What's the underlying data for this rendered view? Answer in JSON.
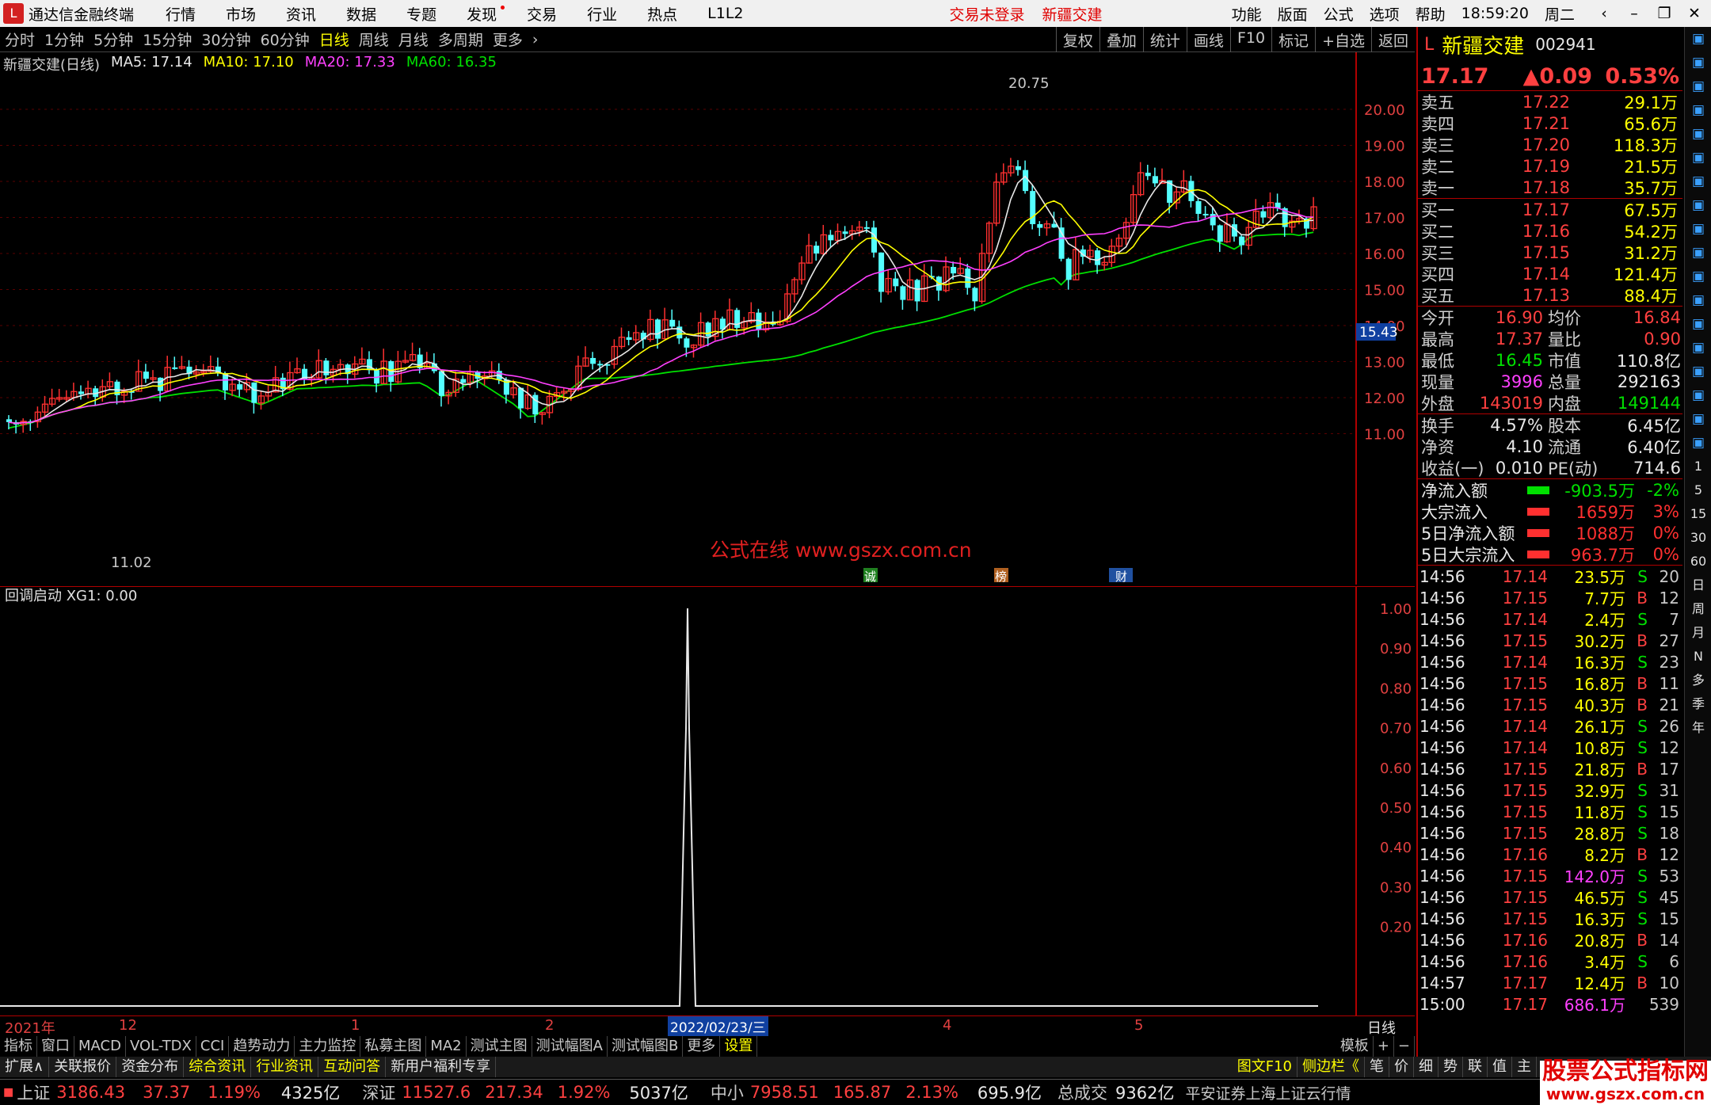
{
  "menubar": {
    "app_title": "通达信金融终端",
    "items": [
      "行情",
      "市场",
      "资讯",
      "数据",
      "专题",
      "发现",
      "交易",
      "行业",
      "热点",
      "L1L2"
    ],
    "trade_status": "交易未登录",
    "stock_name": "新疆交建",
    "right_items": [
      "功能",
      "版面",
      "公式",
      "选项",
      "帮助"
    ],
    "time": "18:59:20",
    "weekday": "周二"
  },
  "periodbar": {
    "periods": [
      "分时",
      "1分钟",
      "5分钟",
      "15分钟",
      "30分钟",
      "60分钟",
      "日线",
      "周线",
      "月线",
      "多周期",
      "更多"
    ],
    "active": "日线",
    "tools": [
      "复权",
      "叠加",
      "统计",
      "画线",
      "F10",
      "标记",
      "+自选",
      "返回"
    ]
  },
  "ma_header": {
    "title": "新疆交建(日线)",
    "ma5": "MA5: 17.14",
    "ma10": "MA10: 17.10",
    "ma20": "MA20: 17.33",
    "ma60": "MA60: 16.35"
  },
  "main_chart": {
    "y_labels": [
      "20.00",
      "19.00",
      "18.00",
      "17.00",
      "16.00",
      "15.00",
      "14.00",
      "13.00",
      "12.00",
      "11.00"
    ],
    "high_label": "20.75",
    "low_label": "11.02",
    "current_price_tag": "15.43",
    "watermark": "公式在线  www.gszx.com.cn",
    "markers": [
      "诚",
      "榜",
      "财"
    ]
  },
  "sub_chart": {
    "title": "回调启动  XG1: 0.00",
    "y_labels": [
      "1.00",
      "0.90",
      "0.80",
      "0.70",
      "0.60",
      "0.50",
      "0.40",
      "0.30",
      "0.20"
    ]
  },
  "datebar": {
    "labels": [
      "2021年",
      "12",
      "1",
      "2",
      "4",
      "5"
    ],
    "cursor_date": "2022/02/23/三",
    "period_label": "日线"
  },
  "tabbar": {
    "tabs": [
      "指标",
      "窗口",
      "MACD",
      "VOL-TDX",
      "CCI",
      "趋势动力",
      "主力监控",
      "私募主图",
      "MA2",
      "测试主图",
      "测试幅图A",
      "测试幅图B",
      "更多",
      "设置"
    ],
    "right": [
      "模板",
      "+",
      "−"
    ]
  },
  "extbar": {
    "items": [
      "扩展∧",
      "关联报价",
      "资金分布",
      "综合资讯",
      "行业资讯",
      "互动问答",
      "新用户福利专享"
    ],
    "right": [
      "图文F10",
      "侧边栏《",
      "笔",
      "价",
      "细",
      "势",
      "联",
      "值",
      "主"
    ]
  },
  "statusbar": {
    "sh_label": "上证",
    "sh_val": "3186.43",
    "sh_chg": "37.37",
    "sh_pct": "1.19%",
    "sh_amt": "4325亿",
    "sz_label": "深证",
    "sz_val": "11527.6",
    "sz_chg": "217.34",
    "sz_pct": "1.92%",
    "sz_amt": "5037亿",
    "zx_label": "中小",
    "zx_val": "7958.51",
    "zx_chg": "165.87",
    "zx_pct": "2.13%",
    "zx_amt": "695.9亿",
    "total_label": "总成交",
    "total_val": "9362亿",
    "broker": "平安证券上海上证云行情"
  },
  "quote": {
    "name": "新疆交建",
    "code": "002941",
    "price": "17.17",
    "change": "▲0.09",
    "pct": "0.53%",
    "asks": [
      {
        "label": "卖五",
        "price": "17.22",
        "vol": "29.1万"
      },
      {
        "label": "卖四",
        "price": "17.21",
        "vol": "65.6万"
      },
      {
        "label": "卖三",
        "price": "17.20",
        "vol": "118.3万"
      },
      {
        "label": "卖二",
        "price": "17.19",
        "vol": "21.5万"
      },
      {
        "label": "卖一",
        "price": "17.18",
        "vol": "35.7万"
      }
    ],
    "bids": [
      {
        "label": "买一",
        "price": "17.17",
        "vol": "67.5万"
      },
      {
        "label": "买二",
        "price": "17.16",
        "vol": "54.2万"
      },
      {
        "label": "买三",
        "price": "17.15",
        "vol": "31.2万"
      },
      {
        "label": "买四",
        "price": "17.14",
        "vol": "121.4万"
      },
      {
        "label": "买五",
        "price": "17.13",
        "vol": "88.4万"
      }
    ],
    "stats1": [
      {
        "a": "今开",
        "av": "16.90",
        "b": "均价",
        "bv": "16.84"
      },
      {
        "a": "最高",
        "av": "17.37",
        "b": "量比",
        "bv": "0.90"
      },
      {
        "a": "最低",
        "av": "16.45",
        "b": "市值",
        "bv": "110.8亿"
      },
      {
        "a": "现量",
        "av": "3996",
        "b": "总量",
        "bv": "292163"
      },
      {
        "a": "外盘",
        "av": "143019",
        "b": "内盘",
        "bv": "149144"
      }
    ],
    "stats2": [
      {
        "a": "换手",
        "av": "4.57%",
        "b": "股本",
        "bv": "6.45亿"
      },
      {
        "a": "净资",
        "av": "4.10",
        "b": "流通",
        "bv": "6.40亿"
      },
      {
        "a": "收益(一)",
        "av": "0.010",
        "b": "PE(动)",
        "bv": "714.6"
      }
    ],
    "flows": [
      {
        "label": "净流入额",
        "val": "-903.5万",
        "pct": "-2%",
        "color": "#00e000"
      },
      {
        "label": "大宗流入",
        "val": "1659万",
        "pct": "3%",
        "color": "#ff3030"
      },
      {
        "label": "5日净流入额",
        "val": "1088万",
        "pct": "0%",
        "color": "#ff3030"
      },
      {
        "label": "5日大宗流入",
        "val": "963.7万",
        "pct": "0%",
        "color": "#ff3030"
      }
    ],
    "ticks": [
      {
        "t": "14:56",
        "p": "17.14",
        "v": "23.5万",
        "bs": "S",
        "n": "20"
      },
      {
        "t": "14:56",
        "p": "17.15",
        "v": "7.7万",
        "bs": "B",
        "n": "12"
      },
      {
        "t": "14:56",
        "p": "17.14",
        "v": "2.4万",
        "bs": "S",
        "n": "7"
      },
      {
        "t": "14:56",
        "p": "17.15",
        "v": "30.2万",
        "bs": "B",
        "n": "27"
      },
      {
        "t": "14:56",
        "p": "17.14",
        "v": "16.3万",
        "bs": "S",
        "n": "23"
      },
      {
        "t": "14:56",
        "p": "17.15",
        "v": "16.8万",
        "bs": "B",
        "n": "11"
      },
      {
        "t": "14:56",
        "p": "17.15",
        "v": "40.3万",
        "bs": "B",
        "n": "21"
      },
      {
        "t": "14:56",
        "p": "17.14",
        "v": "26.1万",
        "bs": "S",
        "n": "26"
      },
      {
        "t": "14:56",
        "p": "17.14",
        "v": "10.8万",
        "bs": "S",
        "n": "12"
      },
      {
        "t": "14:56",
        "p": "17.15",
        "v": "21.8万",
        "bs": "B",
        "n": "17"
      },
      {
        "t": "14:56",
        "p": "17.15",
        "v": "32.9万",
        "bs": "S",
        "n": "31"
      },
      {
        "t": "14:56",
        "p": "17.15",
        "v": "11.8万",
        "bs": "S",
        "n": "15"
      },
      {
        "t": "14:56",
        "p": "17.15",
        "v": "28.8万",
        "bs": "S",
        "n": "18"
      },
      {
        "t": "14:56",
        "p": "17.16",
        "v": "8.2万",
        "bs": "B",
        "n": "12"
      },
      {
        "t": "14:56",
        "p": "17.15",
        "v": "142.0万",
        "bs": "S",
        "n": "53"
      },
      {
        "t": "14:56",
        "p": "17.15",
        "v": "46.5万",
        "bs": "S",
        "n": "45"
      },
      {
        "t": "14:56",
        "p": "17.15",
        "v": "16.3万",
        "bs": "S",
        "n": "15"
      },
      {
        "t": "14:56",
        "p": "17.16",
        "v": "20.8万",
        "bs": "B",
        "n": "14"
      },
      {
        "t": "14:56",
        "p": "17.16",
        "v": "3.4万",
        "bs": "S",
        "n": "6"
      },
      {
        "t": "14:57",
        "p": "17.17",
        "v": "12.4万",
        "bs": "B",
        "n": "10"
      },
      {
        "t": "15:00",
        "p": "17.17",
        "v": "686.1万",
        "bs": "",
        "n": "539"
      }
    ]
  },
  "right_tools": [
    "1",
    "5",
    "15",
    "30",
    "60",
    "日",
    "周",
    "月",
    "N",
    "多",
    "季",
    "年"
  ],
  "corner_watermark": {
    "line1": "股票公式指标网",
    "line2": "www.gszx.com.cn"
  }
}
